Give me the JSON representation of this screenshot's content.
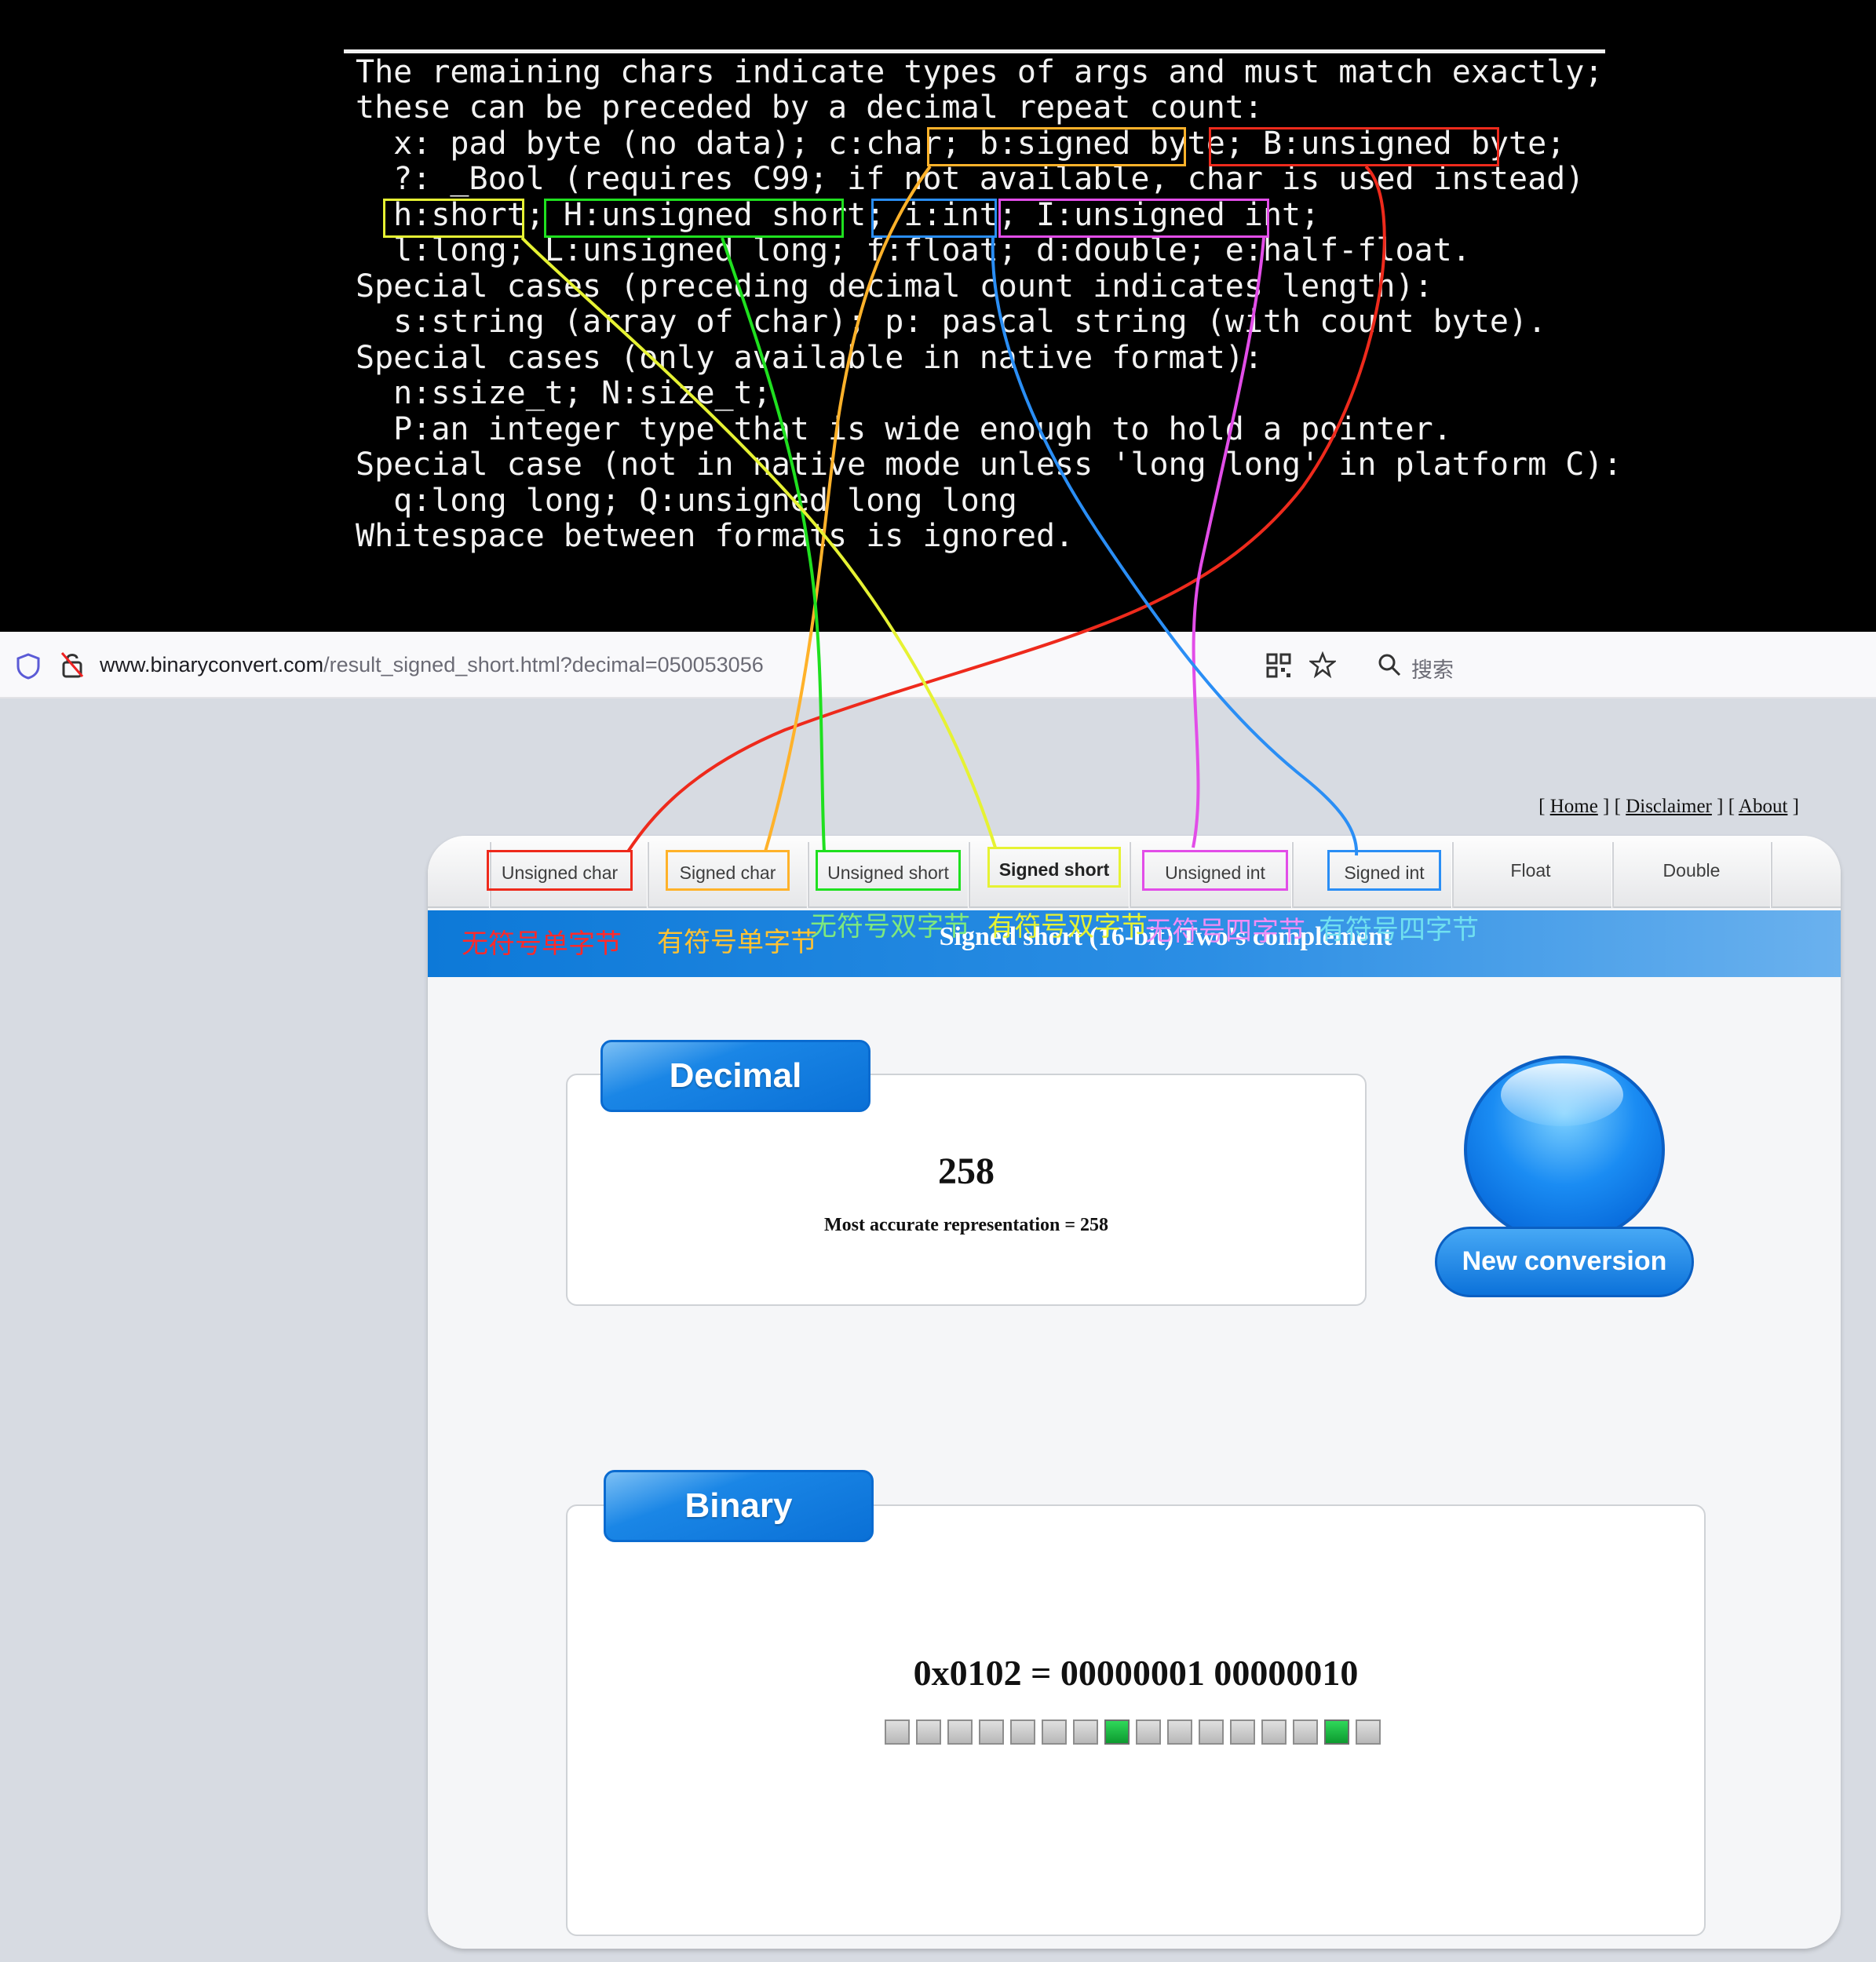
{
  "terminal": {
    "lines": [
      "The remaining chars indicate types of args and must match exactly;",
      "these can be preceded by a decimal repeat count:",
      "  x: pad byte (no data); c:char; b:signed byte; B:unsigned byte;",
      "  ?: _Bool (requires C99; if not available, char is used instead)",
      "  h:short; H:unsigned short; i:int; I:unsigned int;",
      "  l:long; L:unsigned long; f:float; d:double; e:half-float.",
      "Special cases (preceding decimal count indicates length):",
      "  s:string (array of char); p: pascal string (with count byte).",
      "Special cases (only available in native format):",
      "  n:ssize_t; N:size_t;",
      "  P:an integer type that is wide enough to hold a pointer.",
      "Special case (not in native mode unless 'long long' in platform C):",
      "  q:long long; Q:unsigned long long",
      "Whitespace between formats is ignored."
    ]
  },
  "browser": {
    "url_host": "www.binaryconvert.com",
    "url_path": "/result_signed_short.html?decimal=050053056",
    "search_placeholder": "搜索"
  },
  "toplinks": {
    "home": "Home",
    "disclaimer": "Disclaimer",
    "about": "About"
  },
  "tabs": [
    "Unsigned char",
    "Signed char",
    "Unsigned short",
    "Signed short",
    "Unsigned int",
    "Signed int",
    "Float",
    "Double"
  ],
  "banner_title": "Signed short (16-bit) Two's complement",
  "annotations": {
    "unsigned_byte_cn": "无符号单字节",
    "signed_byte_cn": "有符号单字节",
    "unsigned_short_cn": "无符号双字节",
    "signed_short_cn": "有符号双字节",
    "unsigned_int_cn": "无符号四字节",
    "signed_int_cn": "有符号四字节"
  },
  "decimal": {
    "header": "Decimal",
    "value": "258",
    "accuracy": "Most accurate representation = 258"
  },
  "new_conversion_label": "New conversion",
  "binary": {
    "header": "Binary",
    "value": "0x0102 = 00000001 00000010",
    "bits": [
      0,
      0,
      0,
      0,
      0,
      0,
      0,
      1,
      0,
      0,
      0,
      0,
      0,
      0,
      1,
      0
    ]
  },
  "colors": {
    "red": "#ee2a1c",
    "orange": "#ffb22a",
    "green": "#1fe01f",
    "yellow": "#e6f233",
    "blue": "#2a8ef5",
    "magenta": "#e24de8",
    "cn_green_text": "#7ee87e",
    "cn_cyan_text": "#70e0f0"
  }
}
